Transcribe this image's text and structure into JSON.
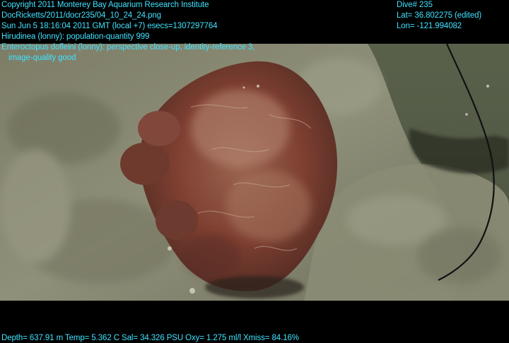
{
  "overlay": {
    "header_lines": [
      "Copyright 2011 Monterey Bay Aquarium Research Institute",
      "DocRicketts/2011/docr235/04_10_24_24.png",
      "Sun Jun  5 18:16:04 2011 GMT (local +7)  esecs=1307297764",
      "Hirudinea (lonny): population-quantity 999",
      "Enteroctopus dofleini (lonny): perspective close-up, identity-reference 3,",
      "image-quality good"
    ],
    "dive": "Dive# 235",
    "lat": "Lat= 36.802275 (edited)",
    "lon": "Lon= -121.994082",
    "footer": "Depth= 637.91 m  Temp= 5.362 C  Sal= 34.326 PSU  Oxy= 1.275 ml/l  Xmiss= 84.16%"
  },
  "colors": {
    "overlay_text": "#3fe3ff",
    "background": "#000000",
    "rock": "#8a8a72",
    "octopus": "#8a4a3a",
    "water": "#5c6650"
  }
}
